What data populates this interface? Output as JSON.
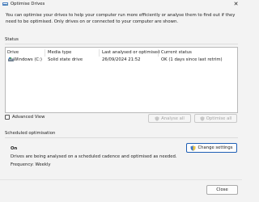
{
  "window": {
    "title": "Optimise Drives",
    "close_glyph": "✕"
  },
  "description": "You can optimise your drives to help your computer run more efficiently or analyse them to find out if they\nneed to be optimised. Only drives on or connected to your computer are shown.",
  "status": {
    "section_label": "Status",
    "columns": [
      "Drive",
      "Media type",
      "Last analysed or optimised",
      "Current status"
    ],
    "rows": [
      {
        "drive": "Windows (C:)",
        "media_type": "Solid state drive",
        "last_optimised": "26/09/2024 21:52",
        "current_status": "OK (1 days since last retrim)"
      }
    ]
  },
  "advanced_view": {
    "label": "Advanced View",
    "checked": false
  },
  "buttons": {
    "analyse_all": "Analyse all",
    "optimise_all": "Optimise all",
    "change_settings": "Change settings",
    "close": "Close"
  },
  "scheduled": {
    "section_label": "Scheduled optimisation",
    "state": "On",
    "description": "Drives are being analysed on a scheduled cadence and optimised as needed.",
    "frequency": "Frequency: Weekly"
  },
  "colors": {
    "accent": "#1f5fb5",
    "window_bg": "#f3f3f3"
  }
}
